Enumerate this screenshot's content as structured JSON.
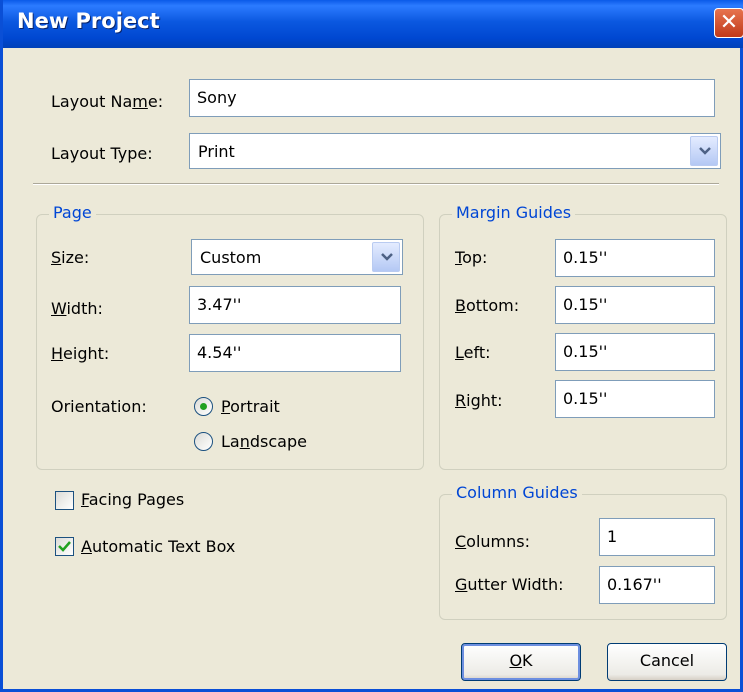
{
  "dialog": {
    "title": "New Project"
  },
  "layout_name": {
    "label_pre": "Layout Na",
    "label_key": "m",
    "label_post": "e:",
    "value": "Sony"
  },
  "layout_type": {
    "label": "Layout Type:",
    "value": "Print"
  },
  "page_group": {
    "title": "Page",
    "size": {
      "label_key": "S",
      "label_post": "ize:",
      "value": "Custom"
    },
    "width": {
      "label_key": "W",
      "label_post": "idth:",
      "value": "3.47''"
    },
    "height": {
      "label_key": "H",
      "label_post": "eight:",
      "value": "4.54''"
    },
    "orientation": {
      "label": "Orientation:",
      "portrait": {
        "label_key": "P",
        "label_post": "ortrait",
        "selected": true
      },
      "landscape": {
        "label_pre": "La",
        "label_key": "n",
        "label_post": "dscape",
        "selected": false
      }
    }
  },
  "margin_group": {
    "title": "Margin Guides",
    "top": {
      "label_key": "T",
      "label_post": "op:",
      "value": "0.15''"
    },
    "bottom": {
      "label_key": "B",
      "label_post": "ottom:",
      "value": "0.15''"
    },
    "left": {
      "label_key": "L",
      "label_post": "eft:",
      "value": "0.15''"
    },
    "right": {
      "label_key": "R",
      "label_post": "ight:",
      "value": "0.15''"
    }
  },
  "facing_pages": {
    "label_key": "F",
    "label_post": "acing Pages",
    "checked": false
  },
  "auto_text_box": {
    "label_key": "A",
    "label_post": "utomatic Text Box",
    "checked": true
  },
  "column_group": {
    "title": "Column Guides",
    "columns": {
      "label_key": "C",
      "label_post": "olumns:",
      "value": "1"
    },
    "gutter": {
      "label_key": "G",
      "label_post": "utter Width:",
      "value": "0.167''"
    }
  },
  "buttons": {
    "ok_key": "O",
    "ok_post": "K",
    "cancel": "Cancel"
  },
  "colors": {
    "title_bar": "#0A5AE8",
    "dialog_bg": "#ECE9D8",
    "group_title": "#0046D5",
    "radio_dot": "#21A121"
  }
}
